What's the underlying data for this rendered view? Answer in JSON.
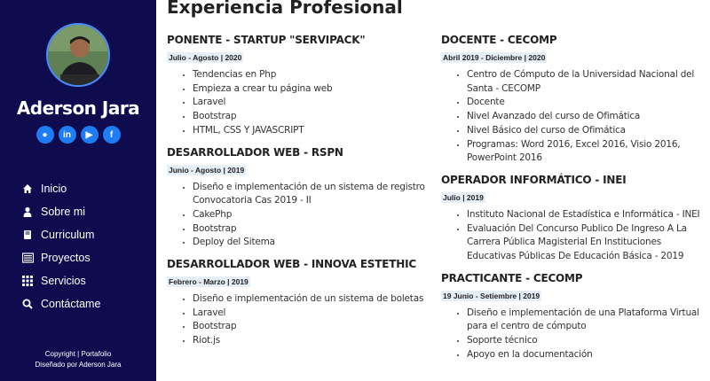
{
  "sidebar": {
    "name": "Aderson Jara",
    "socials": [
      {
        "icon": "github-icon",
        "glyph": "●"
      },
      {
        "icon": "linkedin-icon",
        "glyph": "in"
      },
      {
        "icon": "youtube-icon",
        "glyph": "▶"
      },
      {
        "icon": "facebook-icon",
        "glyph": "f"
      }
    ],
    "nav": [
      {
        "label": "Inicio",
        "icon": "home-icon"
      },
      {
        "label": "Sobre mi",
        "icon": "user-icon"
      },
      {
        "label": "Curriculum",
        "icon": "book-icon"
      },
      {
        "label": "Proyectos",
        "icon": "list-icon"
      },
      {
        "label": "Servicios",
        "icon": "grid-icon"
      },
      {
        "label": "Contáctame",
        "icon": "search-icon"
      }
    ],
    "footer_line1": "Copyright | Portafolio",
    "footer_line2": "Diseñado por Aderson Jara",
    "accent": "#1e7cf5",
    "background": "#0e0b4e"
  },
  "main": {
    "title": "Experiencia Profesional",
    "left_jobs": [
      {
        "title": "PONENTE - STARTUP \"SERVIPACK\"",
        "date": "Julio - Agosto | 2020",
        "items": [
          "Tendencias en Php",
          "Empieza a crear tu página web",
          "Laravel",
          "Bootstrap",
          "HTML, CSS Y JAVASCRIPT"
        ]
      },
      {
        "title": "DESARROLLADOR WEB - RSPN",
        "date": "Junio - Agosto | 2019",
        "items": [
          "Diseño e implementación de un sistema de registro Convocatoria Cas 2019 - II",
          "CakePhp",
          "Bootstrap",
          "Deploy del Sitema"
        ]
      },
      {
        "title": "DESARROLLADOR WEB - INNOVA ESTETHIC",
        "date": "Febrero - Marzo | 2019",
        "items": [
          "Diseño e implementación de un sistema de boletas",
          "Laravel",
          "Bootstrap",
          "Riot.js"
        ]
      }
    ],
    "right_jobs": [
      {
        "title": "DOCENTE - CECOMP",
        "date": "Abril 2019 - Diciembre | 2020",
        "items": [
          "Centro de Cómputo de la Universidad Nacional del Santa - CECOMP",
          "Docente",
          "Nivel Avanzado del curso de Ofimática",
          "Nivel Básico del curso de Ofimática",
          "Programas: Word 2016, Excel 2016, Visio 2016, PowerPoint 2016"
        ]
      },
      {
        "title": "OPERADOR INFORMÁTICO - INEI",
        "date": "Julio | 2019",
        "items": [
          "Instituto Nacional de Estadística e Informática - INEI",
          "Evaluación Del Concurso Publico De Ingreso A La Carrera Pública Magisterial En Instituciones Educativas Públicas De Educación Básica - 2019"
        ]
      },
      {
        "title": "PRACTICANTE - CECOMP",
        "date": "19 Junio - Setiembre | 2019",
        "items": [
          "Diseño e implementación de una Plataforma Virtual para el centro de cómputo",
          "Soporte técnico",
          "Apoyo en la documentación"
        ]
      }
    ]
  }
}
